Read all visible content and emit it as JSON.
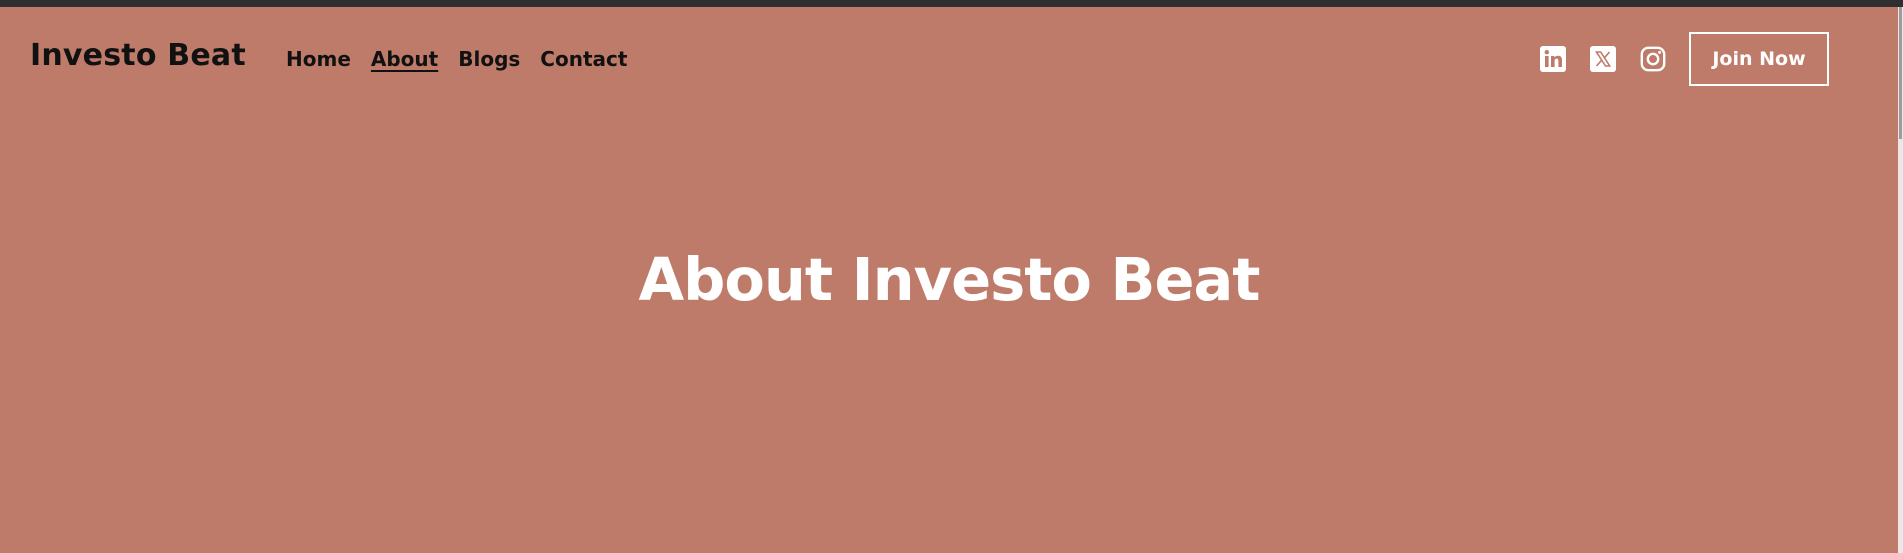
{
  "brand": {
    "name": "Investo Beat"
  },
  "nav": {
    "items": [
      {
        "label": "Home",
        "active": false
      },
      {
        "label": "About",
        "active": true
      },
      {
        "label": "Blogs",
        "active": false
      },
      {
        "label": "Contact",
        "active": false
      }
    ]
  },
  "socials": {
    "icons": [
      "linkedin-icon",
      "x-icon",
      "instagram-icon"
    ]
  },
  "cta": {
    "label": "Join Now"
  },
  "hero": {
    "title": "About Investo Beat"
  },
  "colors": {
    "background": "#bf7b69",
    "top_strip": "#2f2f2f",
    "text_dark": "#111111",
    "text_light": "#ffffff"
  }
}
